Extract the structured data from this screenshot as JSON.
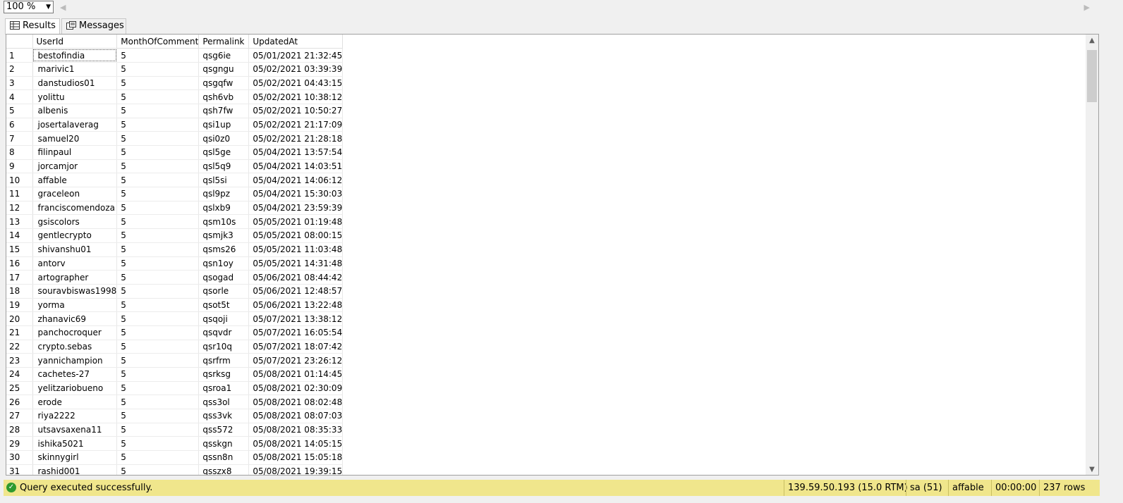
{
  "toolbar": {
    "zoom": "100 %"
  },
  "tabs": [
    {
      "label": "Results",
      "icon": "grid-icon"
    },
    {
      "label": "Messages",
      "icon": "messages-icon"
    }
  ],
  "grid": {
    "columns": [
      "UserId",
      "MonthOfComment",
      "Permalink",
      "UpdatedAt"
    ],
    "rows": [
      [
        "1",
        "bestofindia",
        "5",
        "qsg6ie",
        "05/01/2021 21:32:45"
      ],
      [
        "2",
        "marivic1",
        "5",
        "qsgngu",
        "05/02/2021 03:39:39"
      ],
      [
        "3",
        "danstudios01",
        "5",
        "qsgqfw",
        "05/02/2021 04:43:15"
      ],
      [
        "4",
        "yolittu",
        "5",
        "qsh6vb",
        "05/02/2021 10:38:12"
      ],
      [
        "5",
        "albenis",
        "5",
        "qsh7fw",
        "05/02/2021 10:50:27"
      ],
      [
        "6",
        "josertalaverag",
        "5",
        "qsi1up",
        "05/02/2021 21:17:09"
      ],
      [
        "7",
        "samuel20",
        "5",
        "qsi0z0",
        "05/02/2021 21:28:18"
      ],
      [
        "8",
        "filinpaul",
        "5",
        "qsl5ge",
        "05/04/2021 13:57:54"
      ],
      [
        "9",
        "jorcamjor",
        "5",
        "qsl5q9",
        "05/04/2021 14:03:51"
      ],
      [
        "10",
        "affable",
        "5",
        "qsl5si",
        "05/04/2021 14:06:12"
      ],
      [
        "11",
        "graceleon",
        "5",
        "qsl9pz",
        "05/04/2021 15:30:03"
      ],
      [
        "12",
        "franciscomendoza",
        "5",
        "qslxb9",
        "05/04/2021 23:59:39"
      ],
      [
        "13",
        "gsiscolors",
        "5",
        "qsm10s",
        "05/05/2021 01:19:48"
      ],
      [
        "14",
        "gentlecrypto",
        "5",
        "qsmjk3",
        "05/05/2021 08:00:15"
      ],
      [
        "15",
        "shivanshu01",
        "5",
        "qsms26",
        "05/05/2021 11:03:48"
      ],
      [
        "16",
        "antorv",
        "5",
        "qsn1oy",
        "05/05/2021 14:31:48"
      ],
      [
        "17",
        "artographer",
        "5",
        "qsogad",
        "05/06/2021 08:44:42"
      ],
      [
        "18",
        "souravbiswas1998",
        "5",
        "qsorle",
        "05/06/2021 12:48:57"
      ],
      [
        "19",
        "yorma",
        "5",
        "qsot5t",
        "05/06/2021 13:22:48"
      ],
      [
        "20",
        "zhanavic69",
        "5",
        "qsqoji",
        "05/07/2021 13:38:12"
      ],
      [
        "21",
        "panchocroquer",
        "5",
        "qsqvdr",
        "05/07/2021 16:05:54"
      ],
      [
        "22",
        "crypto.sebas",
        "5",
        "qsr10q",
        "05/07/2021 18:07:42"
      ],
      [
        "23",
        "yannichampion",
        "5",
        "qsrfrm",
        "05/07/2021 23:26:12"
      ],
      [
        "24",
        "cachetes-27",
        "5",
        "qsrksg",
        "05/08/2021 01:14:45"
      ],
      [
        "25",
        "yelitzariobueno",
        "5",
        "qsroa1",
        "05/08/2021 02:30:09"
      ],
      [
        "26",
        "erode",
        "5",
        "qss3ol",
        "05/08/2021 08:02:48"
      ],
      [
        "27",
        "riya2222",
        "5",
        "qss3vk",
        "05/08/2021 08:07:03"
      ],
      [
        "28",
        "utsavsaxena11",
        "5",
        "qss572",
        "05/08/2021 08:35:33"
      ],
      [
        "29",
        "ishika5021",
        "5",
        "qsskgn",
        "05/08/2021 14:05:15"
      ],
      [
        "30",
        "skinnygirl",
        "5",
        "qssn8n",
        "05/08/2021 15:05:18"
      ],
      [
        "31",
        "rashid001",
        "5",
        "qsszx8",
        "05/08/2021 19:39:15"
      ]
    ]
  },
  "status": {
    "message": "Query executed successfully.",
    "server": "139.59.50.193 (15.0 RTM)",
    "user": "sa (51)",
    "database": "affable",
    "elapsed": "00:00:00",
    "rowcount": "237 rows",
    "bar_color": "#f0e68c"
  }
}
